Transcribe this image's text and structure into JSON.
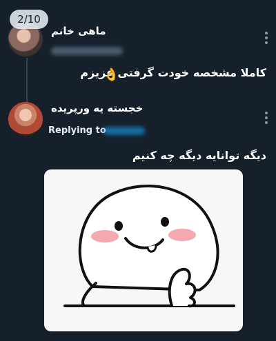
{
  "media_counter": "2/10",
  "tweets": [
    {
      "author_name": "ماهی خانم",
      "text": "کاملا مشخصه خودت گرفتی عزیزم",
      "emoji": "👌"
    },
    {
      "author_name": "خجسته یه ورپریده",
      "replying_label": "Replying to",
      "text": "دیگه توانایه دیگه چه کنیم"
    }
  ],
  "icons": [
    "more-vertical-icon",
    "ok-hand-emoji"
  ],
  "colors": {
    "background": "#15202b",
    "thread_line": "#38444d",
    "link": "#1d9bf0",
    "muted": "#8899a6"
  }
}
